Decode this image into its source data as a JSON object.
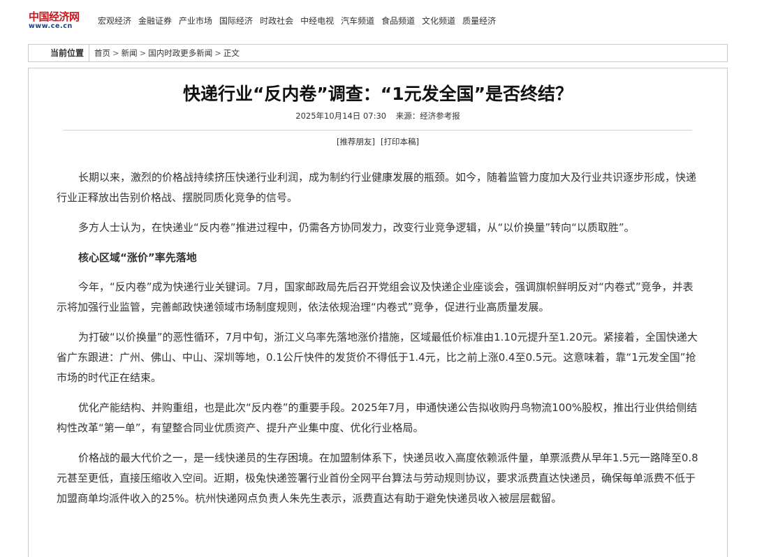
{
  "header": {
    "logo_top": "中国经济网",
    "logo_bottom": "www.ce.cn",
    "nav": [
      "宏观经济",
      "金融证券",
      "产业市场",
      "国际经济",
      "时政社会",
      "中经电视",
      "汽车频道",
      "食品频道",
      "文化频道",
      "质量经济"
    ]
  },
  "breadcrumb": {
    "label": "当前位置",
    "items": [
      "首页",
      "新闻",
      "国内时政更多新闻",
      "正文"
    ],
    "separator": ">"
  },
  "article": {
    "title": "快递行业“反内卷”调查：“1元发全国”是否终结？",
    "datetime": "2025年10月14日 07:30",
    "source": "来源：经济参考报",
    "tools": [
      "[推荐朋友]",
      "[打印本稿]"
    ],
    "paragraphs": [
      "长期以来，激烈的价格战持续挤压快递行业利润，成为制约行业健康发展的瓶颈。如今，随着监管力度加大及行业共识逐步形成，快递行业正释放出告别价格战、摆脱同质化竞争的信号。",
      "多方人士认为，在快递业“反内卷”推进过程中，仍需各方协同发力，改变行业竞争逻辑，从“以价换量”转向“以质取胜”。"
    ],
    "subheading": "核心区域“涨价”率先落地",
    "paragraphs2": [
      "今年，“反内卷”成为快递行业关键词。7月，国家邮政局先后召开党组会议及快递企业座谈会，强调旗帜鲜明反对“内卷式”竞争，并表示将加强行业监管，完善邮政快递领域市场制度规则，依法依规治理“内卷式”竞争，促进行业高质量发展。",
      "为打破“以价换量”的恶性循环，7月中旬，浙江义乌率先落地涨价措施，区域最低价标准由1.10元提升至1.20元。紧接着，全国快递大省广东跟进：广州、佛山、中山、深圳等地，0.1公斤快件的发货价不得低于1.4元，比之前上涨0.4至0.5元。这意味着，靠“1元发全国”抢市场的时代正在结束。",
      "优化产能结构、并购重组，也是此次“反内卷”的重要手段。2025年7月，申通快递公告拟收购丹鸟物流100%股权，推出行业供给侧结构性改革“第一单”，有望整合同业优质资产、提升产业集中度、优化行业格局。",
      "价格战的最大代价之一，是一线快递员的生存困境。在加盟制体系下，快递员收入高度依赖派件量，单票派费从早年1.5元一路降至0.8元甚至更低，直接压缩收入空间。近期，极兔快递签署行业首份全网平台算法与劳动规则协议，要求派费直达快递员，确保每单派费不低于加盟商单均派件收入的25%。杭州快递网点负责人朱先生表示，派费直达有助于避免快递员收入被层层截留。"
    ]
  }
}
